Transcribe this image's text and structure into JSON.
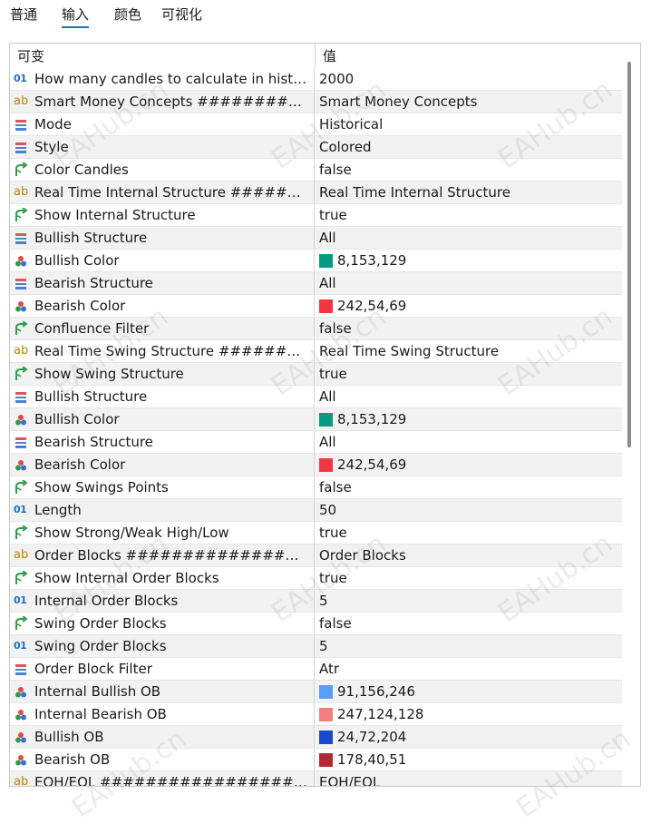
{
  "tabs": [
    "普通",
    "输入",
    "颜色",
    "可视化"
  ],
  "active_tab": 1,
  "header": {
    "variable": "可变",
    "value": "值"
  },
  "rows": [
    {
      "icon": "int",
      "name": "How many candles to calculate in history",
      "value": "2000"
    },
    {
      "icon": "str",
      "name": "Smart Money Concepts ###################",
      "value": "Smart Money Concepts"
    },
    {
      "icon": "enum",
      "name": "Mode",
      "value": "Historical"
    },
    {
      "icon": "enum",
      "name": "Style",
      "value": "Colored"
    },
    {
      "icon": "bool",
      "name": "Color Candles",
      "value": "false"
    },
    {
      "icon": "str",
      "name": "Real Time Internal Structure #############",
      "value": "Real Time Internal Structure"
    },
    {
      "icon": "bool",
      "name": "Show Internal Structure",
      "value": "true"
    },
    {
      "icon": "enum",
      "name": "Bullish Structure",
      "value": "All"
    },
    {
      "icon": "color",
      "name": "Bullish Color",
      "value": "8,153,129",
      "swatch": "#089981"
    },
    {
      "icon": "enum",
      "name": "Bearish Structure",
      "value": "All"
    },
    {
      "icon": "color",
      "name": "Bearish Color",
      "value": "242,54,69",
      "swatch": "#f23645"
    },
    {
      "icon": "bool",
      "name": "Confluence Filter",
      "value": "false"
    },
    {
      "icon": "str",
      "name": "Real Time Swing Structure ################",
      "value": "Real Time Swing Structure"
    },
    {
      "icon": "bool",
      "name": "Show Swing Structure",
      "value": "true"
    },
    {
      "icon": "enum",
      "name": "Bullish Structure",
      "value": "All"
    },
    {
      "icon": "color",
      "name": "Bullish Color",
      "value": "8,153,129",
      "swatch": "#089981"
    },
    {
      "icon": "enum",
      "name": "Bearish Structure",
      "value": "All"
    },
    {
      "icon": "color",
      "name": "Bearish Color",
      "value": "242,54,69",
      "swatch": "#f23645"
    },
    {
      "icon": "bool",
      "name": "Show Swings Points",
      "value": "false"
    },
    {
      "icon": "int",
      "name": "Length",
      "value": "50"
    },
    {
      "icon": "bool",
      "name": "Show Strong/Weak High/Low",
      "value": "true"
    },
    {
      "icon": "str",
      "name": "Order Blocks ##############################",
      "value": "Order Blocks"
    },
    {
      "icon": "bool",
      "name": "Show Internal Order Blocks",
      "value": "true"
    },
    {
      "icon": "int",
      "name": "Internal Order Blocks",
      "value": "5"
    },
    {
      "icon": "bool",
      "name": "Swing Order Blocks",
      "value": "false"
    },
    {
      "icon": "int",
      "name": "Swing Order Blocks",
      "value": "5"
    },
    {
      "icon": "enum",
      "name": "Order Block Filter",
      "value": "Atr"
    },
    {
      "icon": "color",
      "name": "Internal Bullish OB",
      "value": "91,156,246",
      "swatch": "#5b9cf6"
    },
    {
      "icon": "color",
      "name": "Internal Bearish OB",
      "value": "247,124,128",
      "swatch": "#f77c80"
    },
    {
      "icon": "color",
      "name": "Bullish OB",
      "value": "24,72,204",
      "swatch": "#1848cc"
    },
    {
      "icon": "color",
      "name": "Bearish OB",
      "value": "178,40,51",
      "swatch": "#b22833"
    },
    {
      "icon": "str",
      "name": "EQH/EQL ##########################",
      "value": "EQH/EQL"
    }
  ],
  "watermark": "EAHub.cn",
  "colors": {
    "accent": "#1f6fc5",
    "int_icon": "#1f6fc5",
    "str_icon": "#b8860b"
  }
}
